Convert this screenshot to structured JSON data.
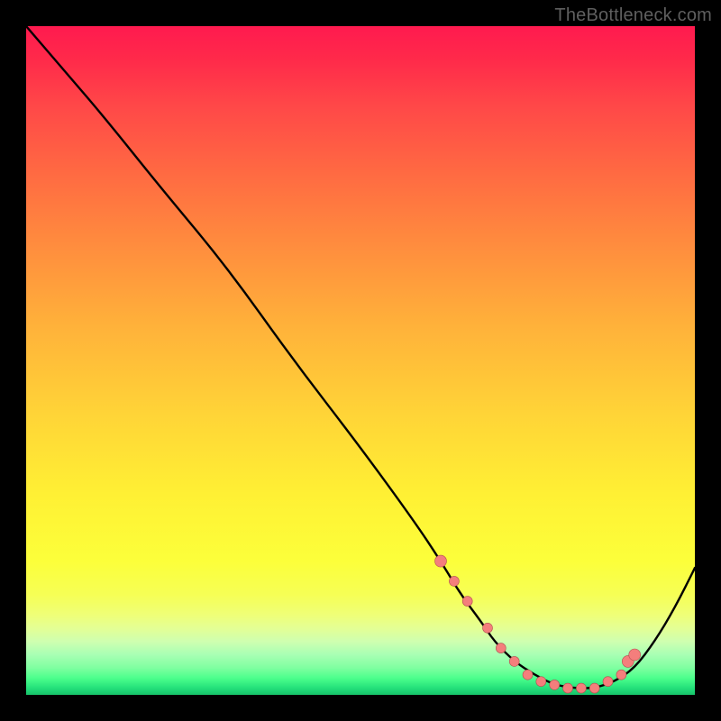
{
  "watermark": "TheBottleneck.com",
  "colors": {
    "background": "#000000",
    "curve": "#000000",
    "marker_fill": "#f47e7c",
    "marker_stroke": "#b35151",
    "gradient_top": "#ff1a4f",
    "gradient_bottom": "#17c36a"
  },
  "chart_data": {
    "type": "line",
    "title": "",
    "xlabel": "",
    "ylabel": "",
    "xlim": [
      0,
      100
    ],
    "ylim": [
      0,
      100
    ],
    "series": [
      {
        "name": "bottleneck-curve",
        "x": [
          0,
          6,
          12,
          20,
          30,
          40,
          50,
          58,
          62,
          65,
          68,
          70,
          73,
          76,
          79,
          82,
          85,
          88,
          91,
          94,
          97,
          100
        ],
        "y": [
          100,
          93,
          86,
          76,
          64,
          50,
          37,
          26,
          20,
          15,
          11,
          8,
          5,
          3,
          1.5,
          1,
          1,
          2,
          4,
          8,
          13,
          19
        ]
      }
    ],
    "markers": {
      "name": "highlighted-points",
      "x": [
        62,
        64,
        66,
        69,
        71,
        73,
        75,
        77,
        79,
        81,
        83,
        85,
        87,
        89,
        90,
        91
      ],
      "y": [
        20,
        17,
        14,
        10,
        7,
        5,
        3,
        2,
        1.5,
        1,
        1,
        1,
        2,
        3,
        5,
        6
      ]
    }
  }
}
